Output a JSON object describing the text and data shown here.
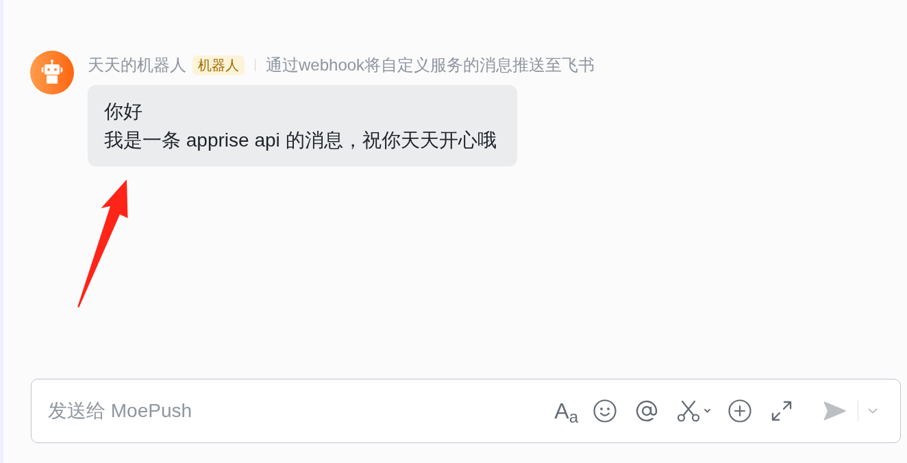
{
  "message": {
    "sender": "天天的机器人",
    "badge": "机器人",
    "description": "通过webhook将自定义服务的消息推送至飞书",
    "lines": [
      "你好",
      "我是一条 apprise api 的消息，祝你天天开心哦"
    ]
  },
  "composer": {
    "placeholder": "发送给 MoePush",
    "format_button": "A$_{a}$",
    "send_button": {
      "disabled": true
    }
  }
}
